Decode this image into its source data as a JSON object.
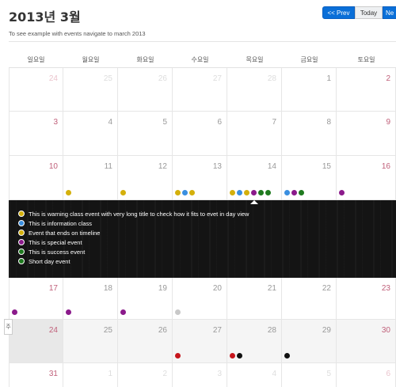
{
  "header": {
    "title": "2013년 3월",
    "subtitle": "To see example with events navigate to march 2013",
    "prev_label": "<< Prev",
    "today_label": "Today",
    "next_label": "Ne"
  },
  "weekdays": [
    "일요일",
    "월요일",
    "화요일",
    "수요일",
    "목요일",
    "금요일",
    "토요일"
  ],
  "colors": {
    "warning": "#d4b00b",
    "info": "#3a8fe0",
    "important": "#c6151c",
    "special": "#8b1a8b",
    "success": "#1f7a1f",
    "inverse": "#111111",
    "default": "#c8c8c8",
    "brand": "#0a6fd8",
    "weekend": "#c0607a"
  },
  "weeks": [
    [
      {
        "d": "24",
        "out": true
      },
      {
        "d": "25",
        "out": true
      },
      {
        "d": "26",
        "out": true
      },
      {
        "d": "27",
        "out": true
      },
      {
        "d": "28",
        "out": true
      },
      {
        "d": "1"
      },
      {
        "d": "2"
      }
    ],
    [
      {
        "d": "3"
      },
      {
        "d": "4"
      },
      {
        "d": "5"
      },
      {
        "d": "6"
      },
      {
        "d": "7"
      },
      {
        "d": "8"
      },
      {
        "d": "9"
      }
    ],
    [
      {
        "d": "10"
      },
      {
        "d": "11",
        "ev": [
          "warning"
        ]
      },
      {
        "d": "12",
        "ev": [
          "warning"
        ]
      },
      {
        "d": "13",
        "ev": [
          "warning",
          "info",
          "warning"
        ]
      },
      {
        "d": "14",
        "ev": [
          "warning",
          "info",
          "warning",
          "special",
          "success",
          "success"
        ]
      },
      {
        "d": "15",
        "ev": [
          "info",
          "special",
          "success"
        ]
      },
      {
        "d": "16",
        "ev": [
          "special"
        ]
      }
    ],
    [
      {
        "d": "17",
        "ev": [
          "special"
        ]
      },
      {
        "d": "18",
        "ev": [
          "special"
        ]
      },
      {
        "d": "19",
        "ev": [
          "special"
        ]
      },
      {
        "d": "20",
        "ev": [
          "default"
        ]
      },
      {
        "d": "21"
      },
      {
        "d": "22"
      },
      {
        "d": "23"
      }
    ],
    [
      {
        "d": "24",
        "today": true
      },
      {
        "d": "25"
      },
      {
        "d": "26"
      },
      {
        "d": "27",
        "ev": [
          "important"
        ]
      },
      {
        "d": "28",
        "ev": [
          "important",
          "inverse"
        ]
      },
      {
        "d": "29",
        "ev": [
          "inverse"
        ]
      },
      {
        "d": "30"
      }
    ],
    [
      {
        "d": "31"
      },
      {
        "d": "1",
        "out": true
      },
      {
        "d": "2",
        "out": true
      },
      {
        "d": "3",
        "out": true
      },
      {
        "d": "4",
        "out": true
      },
      {
        "d": "5",
        "out": true
      },
      {
        "d": "6",
        "out": true
      }
    ]
  ],
  "events": [
    {
      "title": "This is warning class event with very long title to check how it fits to evet in day view",
      "type": "warning"
    },
    {
      "title": "This is information class",
      "type": "info"
    },
    {
      "title": "Event that ends on timeline",
      "type": "warning"
    },
    {
      "title": "This is special event",
      "type": "special"
    },
    {
      "title": "This is success event",
      "type": "success"
    },
    {
      "title": "Short day event",
      "type": "success"
    }
  ],
  "side_tab": "주"
}
